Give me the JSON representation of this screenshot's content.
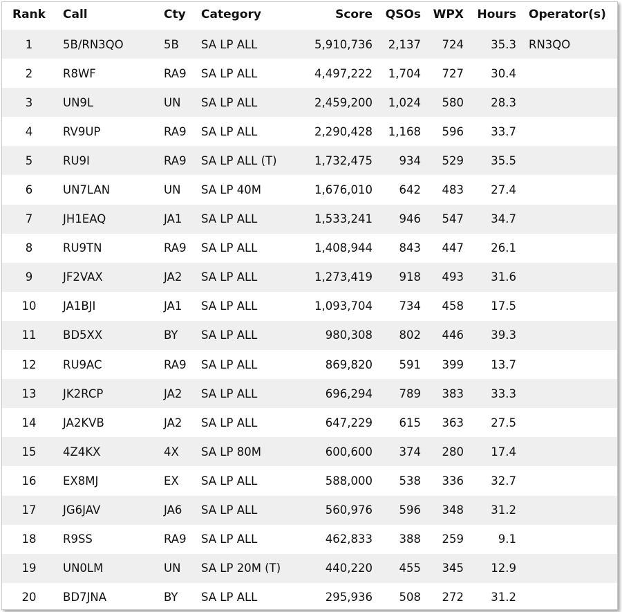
{
  "table": {
    "headers": {
      "rank": "Rank",
      "call": "Call",
      "cty": "Cty",
      "category": "Category",
      "score": "Score",
      "qsos": "QSOs",
      "wpx": "WPX",
      "hours": "Hours",
      "operators": "Operator(s)"
    },
    "rows": [
      {
        "rank": "1",
        "call": "5B/RN3QO",
        "cty": "5B",
        "category": "SA LP ALL",
        "score": "5,910,736",
        "qsos": "2,137",
        "wpx": "724",
        "hours": "35.3",
        "operators": "RN3QO"
      },
      {
        "rank": "2",
        "call": "R8WF",
        "cty": "RA9",
        "category": "SA LP ALL",
        "score": "4,497,222",
        "qsos": "1,704",
        "wpx": "727",
        "hours": "30.4",
        "operators": ""
      },
      {
        "rank": "3",
        "call": "UN9L",
        "cty": "UN",
        "category": "SA LP ALL",
        "score": "2,459,200",
        "qsos": "1,024",
        "wpx": "580",
        "hours": "28.3",
        "operators": ""
      },
      {
        "rank": "4",
        "call": "RV9UP",
        "cty": "RA9",
        "category": "SA LP ALL",
        "score": "2,290,428",
        "qsos": "1,168",
        "wpx": "596",
        "hours": "33.7",
        "operators": ""
      },
      {
        "rank": "5",
        "call": "RU9I",
        "cty": "RA9",
        "category": "SA LP ALL (T)",
        "score": "1,732,475",
        "qsos": "934",
        "wpx": "529",
        "hours": "35.5",
        "operators": ""
      },
      {
        "rank": "6",
        "call": "UN7LAN",
        "cty": "UN",
        "category": "SA LP 40M",
        "score": "1,676,010",
        "qsos": "642",
        "wpx": "483",
        "hours": "27.4",
        "operators": ""
      },
      {
        "rank": "7",
        "call": "JH1EAQ",
        "cty": "JA1",
        "category": "SA LP ALL",
        "score": "1,533,241",
        "qsos": "946",
        "wpx": "547",
        "hours": "34.7",
        "operators": ""
      },
      {
        "rank": "8",
        "call": "RU9TN",
        "cty": "RA9",
        "category": "SA LP ALL",
        "score": "1,408,944",
        "qsos": "843",
        "wpx": "447",
        "hours": "26.1",
        "operators": ""
      },
      {
        "rank": "9",
        "call": "JF2VAX",
        "cty": "JA2",
        "category": "SA LP ALL",
        "score": "1,273,419",
        "qsos": "918",
        "wpx": "493",
        "hours": "31.6",
        "operators": ""
      },
      {
        "rank": "10",
        "call": "JA1BJI",
        "cty": "JA1",
        "category": "SA LP ALL",
        "score": "1,093,704",
        "qsos": "734",
        "wpx": "458",
        "hours": "17.5",
        "operators": ""
      },
      {
        "rank": "11",
        "call": "BD5XX",
        "cty": "BY",
        "category": "SA LP ALL",
        "score": "980,308",
        "qsos": "802",
        "wpx": "446",
        "hours": "39.3",
        "operators": ""
      },
      {
        "rank": "12",
        "call": "RU9AC",
        "cty": "RA9",
        "category": "SA LP ALL",
        "score": "869,820",
        "qsos": "591",
        "wpx": "399",
        "hours": "13.7",
        "operators": ""
      },
      {
        "rank": "13",
        "call": "JK2RCP",
        "cty": "JA2",
        "category": "SA LP ALL",
        "score": "696,294",
        "qsos": "789",
        "wpx": "383",
        "hours": "33.3",
        "operators": ""
      },
      {
        "rank": "14",
        "call": "JA2KVB",
        "cty": "JA2",
        "category": "SA LP ALL",
        "score": "647,229",
        "qsos": "615",
        "wpx": "363",
        "hours": "27.5",
        "operators": ""
      },
      {
        "rank": "15",
        "call": "4Z4KX",
        "cty": "4X",
        "category": "SA LP 80M",
        "score": "600,600",
        "qsos": "374",
        "wpx": "280",
        "hours": "17.4",
        "operators": ""
      },
      {
        "rank": "16",
        "call": "EX8MJ",
        "cty": "EX",
        "category": "SA LP ALL",
        "score": "588,000",
        "qsos": "538",
        "wpx": "336",
        "hours": "32.7",
        "operators": ""
      },
      {
        "rank": "17",
        "call": "JG6JAV",
        "cty": "JA6",
        "category": "SA LP ALL",
        "score": "560,976",
        "qsos": "596",
        "wpx": "348",
        "hours": "31.2",
        "operators": ""
      },
      {
        "rank": "18",
        "call": "R9SS",
        "cty": "RA9",
        "category": "SA LP ALL",
        "score": "462,833",
        "qsos": "388",
        "wpx": "259",
        "hours": "9.1",
        "operators": ""
      },
      {
        "rank": "19",
        "call": "UN0LM",
        "cty": "UN",
        "category": "SA LP 20M (T)",
        "score": "440,220",
        "qsos": "455",
        "wpx": "345",
        "hours": "12.9",
        "operators": ""
      },
      {
        "rank": "20",
        "call": "BD7JNA",
        "cty": "BY",
        "category": "SA LP ALL",
        "score": "295,936",
        "qsos": "508",
        "wpx": "272",
        "hours": "31.2",
        "operators": ""
      }
    ]
  },
  "colors": {
    "row_alt_background": "#efefef",
    "row_background": "#ffffff",
    "text": "#111111"
  }
}
